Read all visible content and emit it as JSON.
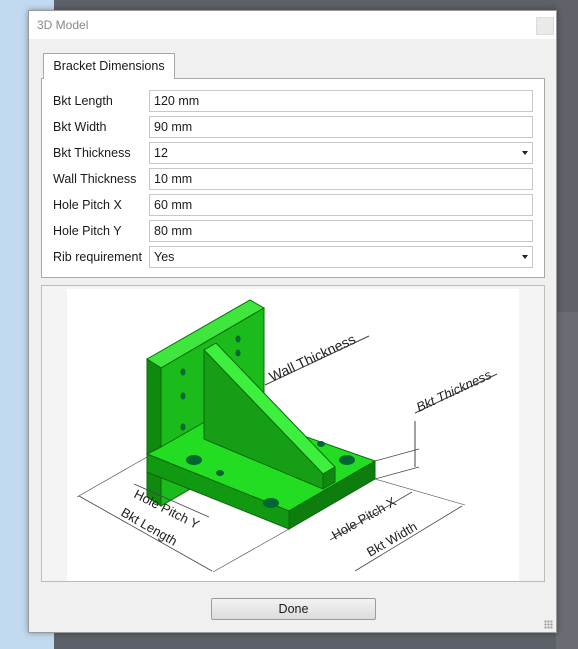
{
  "window": {
    "title": "3D Model"
  },
  "tab": {
    "label": "Bracket Dimensions"
  },
  "fields": [
    {
      "label": "Bkt Length",
      "value": "120 mm",
      "type": "text"
    },
    {
      "label": "Bkt Width",
      "value": "90 mm",
      "type": "text"
    },
    {
      "label": "Bkt Thickness",
      "value": "12",
      "type": "select"
    },
    {
      "label": "Wall Thickness",
      "value": "10 mm",
      "type": "text"
    },
    {
      "label": "Hole Pitch X",
      "value": "60 mm",
      "type": "text"
    },
    {
      "label": "Hole Pitch Y",
      "value": "80 mm",
      "type": "text"
    },
    {
      "label": "Rib requirement",
      "value": "Yes",
      "type": "select"
    }
  ],
  "diagram": {
    "labels": {
      "wall_thickness": "Wall Thickness",
      "bkt_thickness": "Bkt Thickness",
      "hole_pitch_y": "Hole Pitch Y",
      "bkt_length": "Bkt Length",
      "hole_pitch_x": "Hole Pitch X",
      "bkt_width": "Bkt Width"
    },
    "colors": {
      "part": "#22dd22",
      "part_dark": "#119911",
      "part_mid": "#1bbb1b"
    }
  },
  "buttons": {
    "done": "Done"
  }
}
